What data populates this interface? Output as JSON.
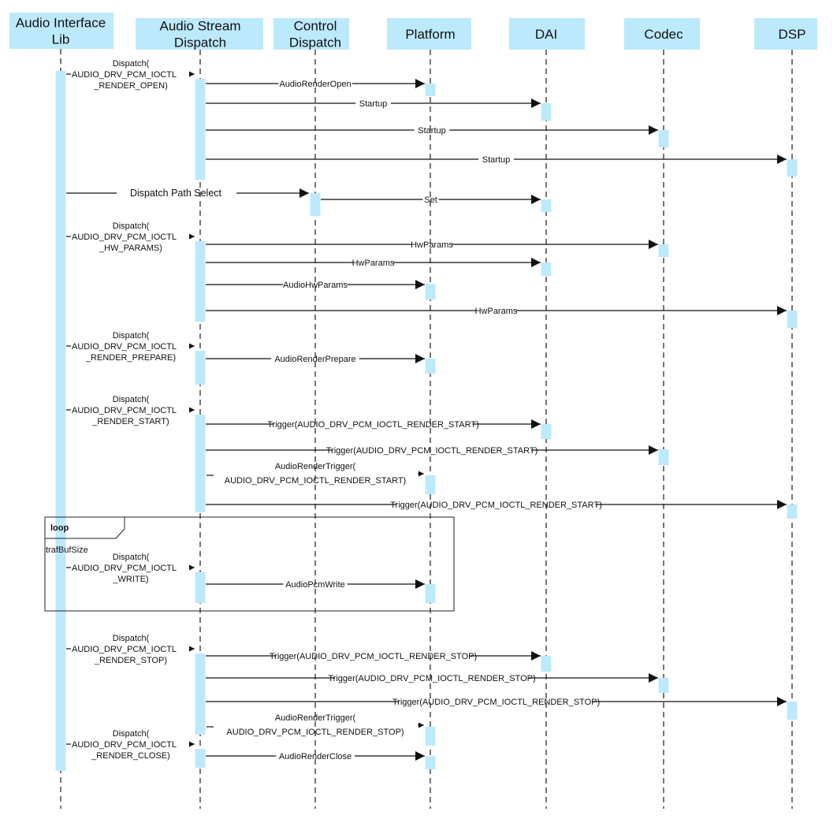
{
  "diagram": {
    "type": "sequence",
    "colors": {
      "header_fill": "#bde9fc",
      "activation_fill": "#bde9fc",
      "line": "#111111",
      "lifeline": "#555555"
    },
    "participants": [
      {
        "id": "ail",
        "label_lines": [
          "Audio Interface",
          "Lib"
        ]
      },
      {
        "id": "asd",
        "label_lines": [
          "Audio Stream",
          "Dispatch"
        ]
      },
      {
        "id": "cd",
        "label_lines": [
          "Control",
          "Dispatch"
        ]
      },
      {
        "id": "plat",
        "label_lines": [
          "Platform"
        ]
      },
      {
        "id": "dai",
        "label_lines": [
          "DAI"
        ]
      },
      {
        "id": "codec",
        "label_lines": [
          "Codec"
        ]
      },
      {
        "id": "dsp",
        "label_lines": [
          "DSP"
        ]
      }
    ],
    "messages": [
      {
        "from": "ail",
        "to": "asd",
        "label_lines": [
          "Dispatch(",
          "AUDIO_DRV_PCM_IOCTL",
          "_RENDER_OPEN)"
        ]
      },
      {
        "from": "asd",
        "to": "plat",
        "label_lines": [
          "AudioRenderOpen"
        ]
      },
      {
        "from": "asd",
        "to": "dai",
        "label_lines": [
          "Startup"
        ]
      },
      {
        "from": "asd",
        "to": "codec",
        "label_lines": [
          "Startup"
        ]
      },
      {
        "from": "asd",
        "to": "dsp",
        "label_lines": [
          "Startup"
        ]
      },
      {
        "from": "ail",
        "to": "cd",
        "label_lines": [
          "Dispatch Path Select"
        ]
      },
      {
        "from": "cd",
        "to": "dai",
        "label_lines": [
          "Set"
        ]
      },
      {
        "from": "ail",
        "to": "asd",
        "label_lines": [
          "Dispatch(",
          "AUDIO_DRV_PCM_IOCTL",
          "_HW_PARAMS)"
        ]
      },
      {
        "from": "asd",
        "to": "codec",
        "label_lines": [
          "HwParams"
        ]
      },
      {
        "from": "asd",
        "to": "dai",
        "label_lines": [
          "HwParams"
        ]
      },
      {
        "from": "asd",
        "to": "plat",
        "label_lines": [
          "AudioHwParams"
        ]
      },
      {
        "from": "asd",
        "to": "dsp",
        "label_lines": [
          "HwParams"
        ]
      },
      {
        "from": "ail",
        "to": "asd",
        "label_lines": [
          "Dispatch(",
          "AUDIO_DRV_PCM_IOCTL",
          "_RENDER_PREPARE)"
        ]
      },
      {
        "from": "asd",
        "to": "plat",
        "label_lines": [
          "AudioRenderPrepare"
        ]
      },
      {
        "from": "ail",
        "to": "asd",
        "label_lines": [
          "Dispatch(",
          "AUDIO_DRV_PCM_IOCTL",
          "_RENDER_START)"
        ]
      },
      {
        "from": "asd",
        "to": "dai",
        "label_lines": [
          "Trigger(AUDIO_DRV_PCM_IOCTL_RENDER_START)"
        ]
      },
      {
        "from": "asd",
        "to": "codec",
        "label_lines": [
          "Trigger(AUDIO_DRV_PCM_IOCTL_RENDER_START)"
        ]
      },
      {
        "from": "asd",
        "to": "plat",
        "label_lines": [
          "AudioRenderTrigger(",
          "AUDIO_DRV_PCM_IOCTL_RENDER_START)"
        ]
      },
      {
        "from": "asd",
        "to": "dsp",
        "label_lines": [
          "Trigger(AUDIO_DRV_PCM_IOCTL_RENDER_START)"
        ]
      },
      {
        "from": "ail",
        "to": "asd",
        "label_lines": [
          "Dispatch(",
          "AUDIO_DRV_PCM_IOCTL",
          "_WRITE)"
        ]
      },
      {
        "from": "asd",
        "to": "plat",
        "label_lines": [
          "AudioPcmWrite"
        ]
      },
      {
        "from": "ail",
        "to": "asd",
        "label_lines": [
          "Dispatch(",
          "AUDIO_DRV_PCM_IOCTL",
          "_RENDER_STOP)"
        ]
      },
      {
        "from": "asd",
        "to": "dai",
        "label_lines": [
          "Trigger(AUDIO_DRV_PCM_IOCTL_RENDER_STOP)"
        ]
      },
      {
        "from": "asd",
        "to": "codec",
        "label_lines": [
          "Trigger(AUDIO_DRV_PCM_IOCTL_RENDER_STOP)"
        ]
      },
      {
        "from": "asd",
        "to": "dsp",
        "label_lines": [
          "Trigger(AUDIO_DRV_PCM_IOCTL_RENDER_STOP)"
        ]
      },
      {
        "from": "asd",
        "to": "plat",
        "label_lines": [
          "AudioRenderTrigger(",
          "AUDIO_DRV_PCM_IOCTL_RENDER_STOP)"
        ]
      },
      {
        "from": "ail",
        "to": "asd",
        "label_lines": [
          "Dispatch(",
          "AUDIO_DRV_PCM_IOCTL",
          "_RENDER_CLOSE)"
        ]
      },
      {
        "from": "asd",
        "to": "plat",
        "label_lines": [
          "AudioRenderClose"
        ]
      }
    ],
    "fragments": [
      {
        "kind": "loop",
        "title": "loop",
        "condition": "trafBufSize",
        "covers_messages": [
          19,
          20
        ]
      }
    ]
  }
}
